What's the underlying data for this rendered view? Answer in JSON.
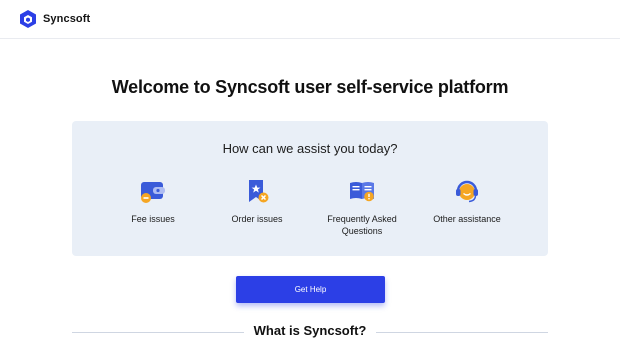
{
  "header": {
    "logo_text": "Syncsoft",
    "logo_icon": "hexagon-cube-logo",
    "brand_color": "#2c3fe6"
  },
  "main": {
    "welcome_title": "Welcome to Syncsoft user self-service platform",
    "panel_title": "How can we assist you today?",
    "options": [
      {
        "label": "Fee issues",
        "icon": "wallet-icon"
      },
      {
        "label": "Order issues",
        "icon": "order-bookmark-icon"
      },
      {
        "label": "Frequently Asked Questions",
        "icon": "book-question-icon"
      },
      {
        "label": "Other assistance",
        "icon": "headset-support-icon"
      }
    ],
    "cta_label": "Get Help",
    "section_title": "What is Syncsoft?"
  },
  "colors": {
    "panel_bg": "#e9eff7",
    "icon_blue": "#3a5bd9",
    "icon_orange": "#f5a623"
  }
}
